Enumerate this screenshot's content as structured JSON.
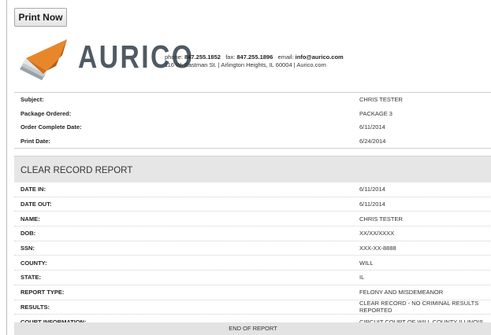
{
  "toolbar": {
    "print_label": "Print Now"
  },
  "header": {
    "brand": "AURICO",
    "phone_label": "phone:",
    "phone": "847.255.1852",
    "fax_label": "fax:",
    "fax": "847.255.1896",
    "email_label": "email:",
    "email": "info@aurico.com",
    "address": "116 W. Eastman St.  |  Arlington Heights, IL 60004  |  Aurico.com"
  },
  "info": [
    {
      "label": "Subject:",
      "value": "CHRIS TESTER"
    },
    {
      "label": "Package Ordered:",
      "value": "PACKAGE 3"
    },
    {
      "label": "Order Complete Date:",
      "value": "6/11/2014"
    },
    {
      "label": "Print Date:",
      "value": "6/24/2014"
    }
  ],
  "report": {
    "title": "CLEAR RECORD REPORT",
    "rows": [
      {
        "label": "DATE IN:",
        "value": "6/11/2014"
      },
      {
        "label": "DATE OUT:",
        "value": "6/11/2014"
      },
      {
        "label": "NAME:",
        "value": "CHRIS TESTER"
      },
      {
        "label": "DOB:",
        "value": "XX/XX/XXXX"
      },
      {
        "label": "SSN:",
        "value": "XXX-XX-8888"
      },
      {
        "label": "COUNTY:",
        "value": "WILL"
      },
      {
        "label": "STATE:",
        "value": "IL"
      },
      {
        "label": "REPORT TYPE:",
        "value": "FELONY AND MISDEMEANOR"
      },
      {
        "label": "RESULTS:",
        "value": "CLEAR RECORD - NO CRIMINAL RESULTS REPORTED"
      },
      {
        "label": "COURT INFORMATION:",
        "value": "CIRCUIT COURT OF WILL COUNTY ILLINOIS"
      }
    ],
    "end_text": "END OF REPORT"
  },
  "colors": {
    "brand_gray": "#505a63",
    "logo_orange": "#e8872a",
    "section_bg": "#e6e6e6"
  }
}
